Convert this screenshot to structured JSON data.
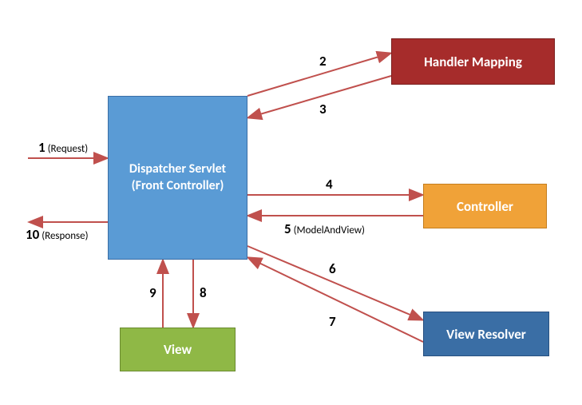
{
  "boxes": {
    "dispatcher": "Dispatcher Servlet<br>(Front Controller)",
    "handler_mapping": "Handler Mapping",
    "controller": "Controller",
    "view_resolver": "View Resolver",
    "view": "View"
  },
  "labels": {
    "l1_num": "1",
    "l1_paren": "(Request)",
    "l2": "2",
    "l3": "3",
    "l4": "4",
    "l5_num": "5",
    "l5_paren": "(ModelAndView)",
    "l6": "6",
    "l7": "7",
    "l8": "8",
    "l9": "9",
    "l10_num": "10",
    "l10_paren": "(Response)"
  },
  "flow": [
    {
      "step": 1,
      "from": "external",
      "to": "Dispatcher Servlet",
      "note": "Request"
    },
    {
      "step": 2,
      "from": "Dispatcher Servlet",
      "to": "Handler Mapping"
    },
    {
      "step": 3,
      "from": "Handler Mapping",
      "to": "Dispatcher Servlet"
    },
    {
      "step": 4,
      "from": "Dispatcher Servlet",
      "to": "Controller"
    },
    {
      "step": 5,
      "from": "Controller",
      "to": "Dispatcher Servlet",
      "note": "ModelAndView"
    },
    {
      "step": 6,
      "from": "Dispatcher Servlet",
      "to": "View Resolver"
    },
    {
      "step": 7,
      "from": "View Resolver",
      "to": "Dispatcher Servlet"
    },
    {
      "step": 8,
      "from": "Dispatcher Servlet",
      "to": "View"
    },
    {
      "step": 9,
      "from": "View",
      "to": "Dispatcher Servlet"
    },
    {
      "step": 10,
      "from": "Dispatcher Servlet",
      "to": "external",
      "note": "Response"
    }
  ]
}
